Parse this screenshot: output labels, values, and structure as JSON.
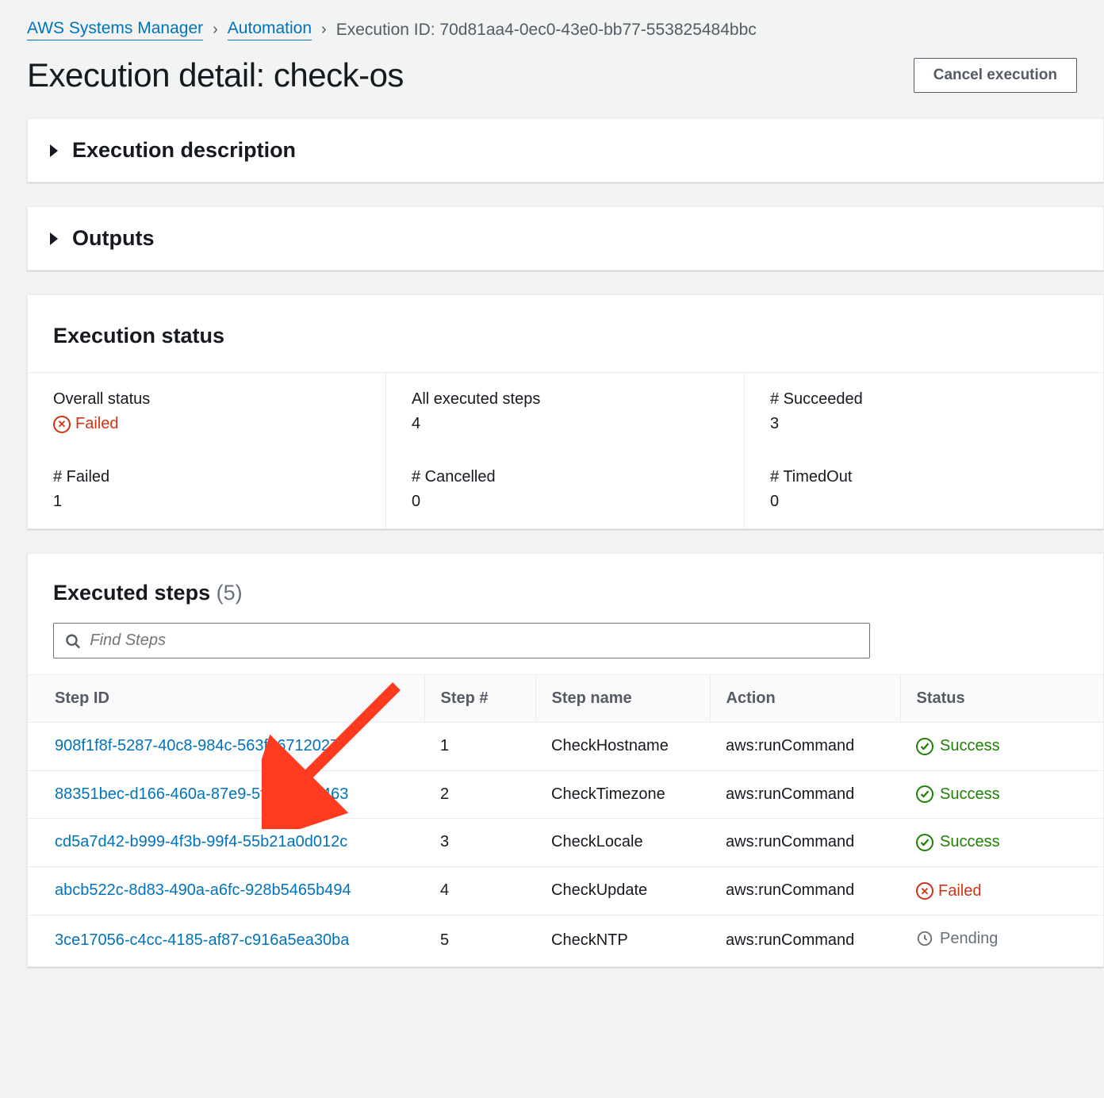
{
  "breadcrumbs": {
    "root": "AWS Systems Manager",
    "automation": "Automation",
    "current": "Execution ID: 70d81aa4-0ec0-43e0-bb77-553825484bbc"
  },
  "page_title": "Execution detail: check-os",
  "actions": {
    "cancel": "Cancel execution"
  },
  "panels": {
    "description": "Execution description",
    "outputs": "Outputs",
    "status_title": "Execution status",
    "steps_title": "Executed steps",
    "steps_count": "(5)"
  },
  "status": {
    "overall_label": "Overall status",
    "overall_value": "Failed",
    "all_label": "All executed steps",
    "all_value": "4",
    "succeeded_label": "# Succeeded",
    "succeeded_value": "3",
    "failed_label": "# Failed",
    "failed_value": "1",
    "cancelled_label": "# Cancelled",
    "cancelled_value": "0",
    "timedout_label": "# TimedOut",
    "timedout_value": "0"
  },
  "search_placeholder": "Find Steps",
  "columns": {
    "step_id": "Step ID",
    "step_num": "Step #",
    "step_name": "Step name",
    "action": "Action",
    "status": "Status"
  },
  "status_labels": {
    "success": "Success",
    "failed": "Failed",
    "pending": "Pending"
  },
  "steps": [
    {
      "id": "908f1f8f-5287-40c8-984c-563f36712027",
      "num": "1",
      "name": "CheckHostname",
      "action": "aws:runCommand",
      "status": "success"
    },
    {
      "id": "88351bec-d166-460a-87e9-5f9303f89463",
      "num": "2",
      "name": "CheckTimezone",
      "action": "aws:runCommand",
      "status": "success"
    },
    {
      "id": "cd5a7d42-b999-4f3b-99f4-55b21a0d012c",
      "num": "3",
      "name": "CheckLocale",
      "action": "aws:runCommand",
      "status": "success"
    },
    {
      "id": "abcb522c-8d83-490a-a6fc-928b5465b494",
      "num": "4",
      "name": "CheckUpdate",
      "action": "aws:runCommand",
      "status": "failed"
    },
    {
      "id": "3ce17056-c4cc-4185-af87-c916a5ea30ba",
      "num": "5",
      "name": "CheckNTP",
      "action": "aws:runCommand",
      "status": "pending"
    }
  ]
}
